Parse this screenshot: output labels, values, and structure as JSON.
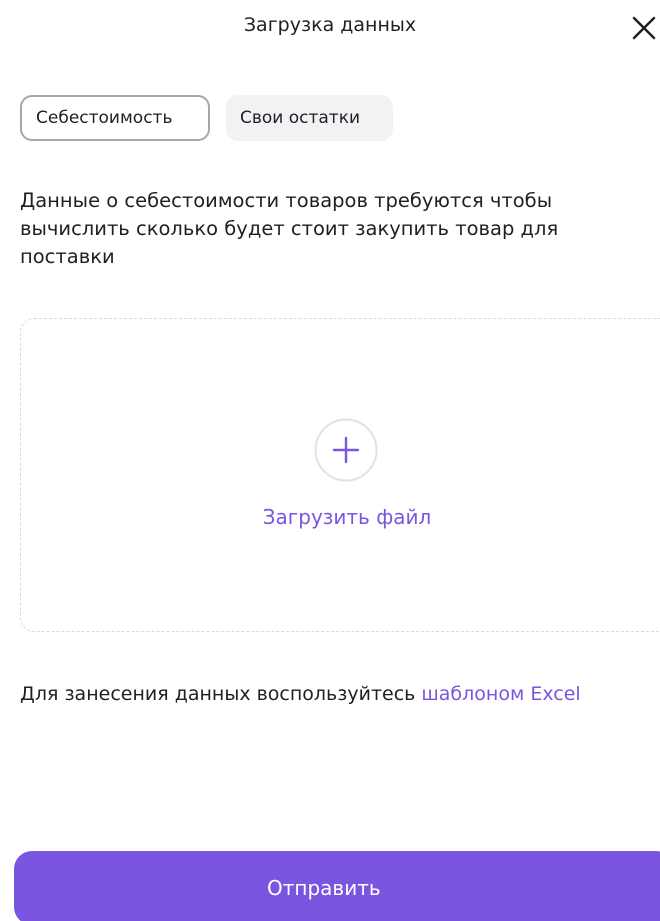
{
  "header": {
    "title": "Загрузка данных",
    "close_icon": "close-icon"
  },
  "tabs": [
    {
      "label": "Себестоимость",
      "active": true
    },
    {
      "label": "Свои остатки",
      "active": false
    }
  ],
  "description": "Данные о себестоимости товаров требуются чтобы вычислить сколько будет стоит закупить товар для поставки",
  "dropzone": {
    "icon": "plus-circle-icon",
    "label": "Загрузить файл"
  },
  "hint": {
    "text": "Для занесения данных воспользуйтесь ",
    "link": "шаблоном Excel"
  },
  "submit": {
    "label": "Отправить"
  },
  "colors": {
    "accent": "#7a55e0",
    "text": "#1f1f24",
    "tab_inactive_bg": "#f2f2f4",
    "tab_active_border": "#a7a7ab",
    "dropzone_border": "#d9d9de"
  }
}
